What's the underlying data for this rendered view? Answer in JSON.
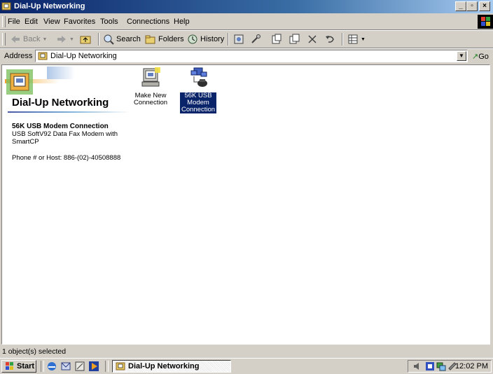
{
  "window": {
    "title": "Dial-Up Networking",
    "controls": [
      "_",
      "▫",
      "×"
    ]
  },
  "menu": [
    "File",
    "Edit",
    "View",
    "Favorites",
    "Tools",
    "Connections",
    "Help"
  ],
  "toolbar": {
    "back": "Back",
    "search": "Search",
    "folders": "Folders",
    "history": "History"
  },
  "address": {
    "label": "Address",
    "value": "Dial-Up Networking",
    "go": "Go"
  },
  "leftpane": {
    "title": "Dial-Up Networking",
    "selected_name": "56K USB Modem Connection",
    "selected_device": "USB SoftV92 Data Fax Modem with SmartCP",
    "phone": "Phone # or Host: 886-(02)-40508888"
  },
  "icons": [
    {
      "label": "Make New Connection",
      "icon": "make-new-connection-icon",
      "selected": false
    },
    {
      "label": "56K USB Modem Connection",
      "icon": "modem-connection-icon",
      "selected": true
    }
  ],
  "status": {
    "text": "1 object(s) selected"
  },
  "taskbar": {
    "start": "Start",
    "task": "Dial-Up Networking",
    "clock": "12:02 PM"
  },
  "colors": {
    "titlebar": "#0a246a",
    "selection": "#0a246a",
    "chrome": "#d4d0c8"
  }
}
